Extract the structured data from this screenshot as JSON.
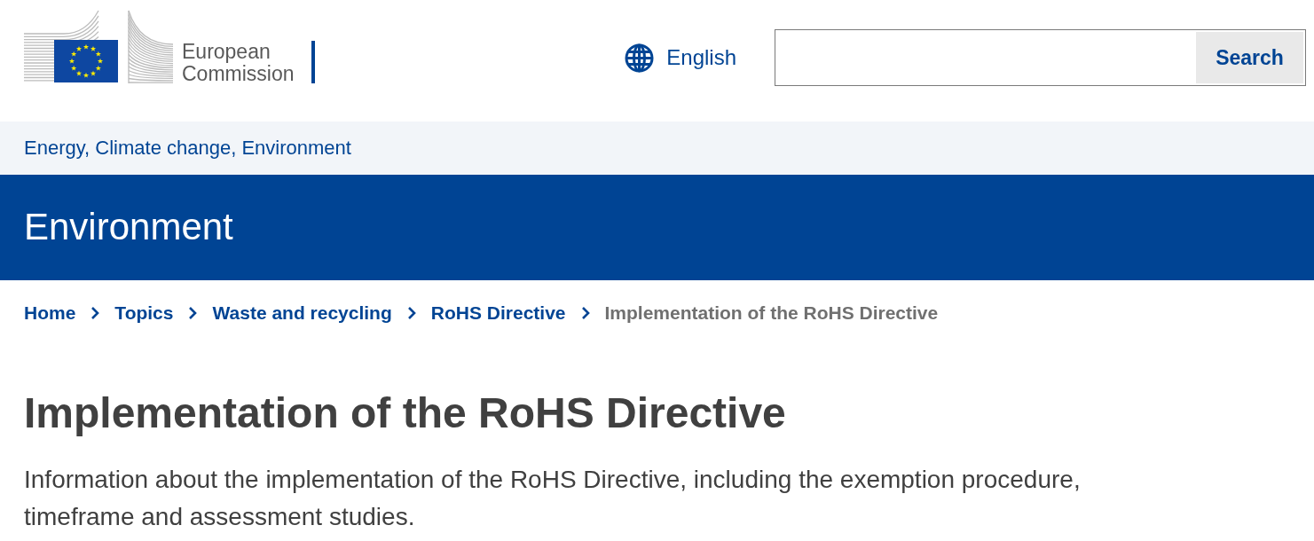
{
  "header": {
    "logo_text": "European Commission",
    "language": "English",
    "search": {
      "button": "Search"
    }
  },
  "site_name": "Energy, Climate change, Environment",
  "banner": {
    "title": "Environment"
  },
  "breadcrumb": [
    {
      "label": "Home",
      "current": false
    },
    {
      "label": "Topics",
      "current": false
    },
    {
      "label": "Waste and recycling",
      "current": false
    },
    {
      "label": "RoHS Directive",
      "current": false
    },
    {
      "label": "Implementation of the RoHS Directive",
      "current": true
    }
  ],
  "page_header": {
    "title": "Implementation of the RoHS Directive",
    "description": "Information about the implementation of the RoHS Directive, including the exemption procedure, timeframe and assessment studies."
  }
}
